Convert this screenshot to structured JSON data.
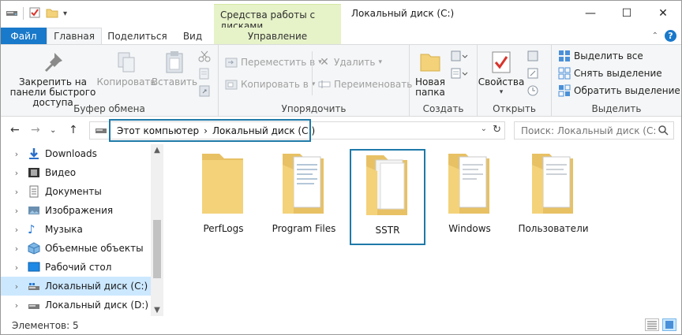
{
  "window": {
    "title": "Локальный диск (C:)",
    "context_group": "Средства работы с дисками",
    "minimize_glyph": "—",
    "maximize_glyph": "☐",
    "close_glyph": "✕"
  },
  "tabs": {
    "file": "Файл",
    "home": "Главная",
    "share": "Поделиться",
    "view": "Вид",
    "manage": "Управление"
  },
  "ribbon": {
    "clipboard": {
      "label": "Буфер обмена",
      "pin": "Закрепить на панели быстрого доступа",
      "copy": "Копировать",
      "paste": "Вставить"
    },
    "organize": {
      "label": "Упорядочить",
      "move_to": "Переместить в",
      "copy_to": "Копировать в",
      "delete": "Удалить",
      "rename": "Переименовать"
    },
    "new": {
      "label": "Создать",
      "new_folder": "Новая папка"
    },
    "open": {
      "label": "Открыть",
      "properties": "Свойства"
    },
    "select": {
      "label": "Выделить",
      "select_all": "Выделить все",
      "select_none": "Снять выделение",
      "invert": "Обратить выделение"
    }
  },
  "address": {
    "crumbs": [
      "Этот компьютер",
      "Локальный диск (C:)"
    ],
    "separator": "›"
  },
  "search": {
    "placeholder": "Поиск: Локальный диск (C:)"
  },
  "navpane": {
    "items": [
      {
        "label": "Downloads",
        "icon": "download-icon"
      },
      {
        "label": "Видео",
        "icon": "video-icon"
      },
      {
        "label": "Документы",
        "icon": "documents-icon"
      },
      {
        "label": "Изображения",
        "icon": "pictures-icon"
      },
      {
        "label": "Музыка",
        "icon": "music-icon"
      },
      {
        "label": "Объемные объекты",
        "icon": "3d-objects-icon"
      },
      {
        "label": "Рабочий стол",
        "icon": "desktop-icon"
      },
      {
        "label": "Локальный диск (C:)",
        "icon": "drive-icon",
        "selected": true
      },
      {
        "label": "Локальный диск (D:)",
        "icon": "drive-icon"
      }
    ]
  },
  "folders": [
    {
      "label": "PerfLogs",
      "variant": "empty"
    },
    {
      "label": "Program Files",
      "variant": "docs"
    },
    {
      "label": "SSTR",
      "variant": "pages",
      "highlighted": true
    },
    {
      "label": "Windows",
      "variant": "docs"
    },
    {
      "label": "Пользователи",
      "variant": "docs"
    }
  ],
  "status": {
    "count_text": "Элементов: 5"
  },
  "colors": {
    "accent": "#1979ca",
    "highlight_border": "#1f7aa8",
    "context_tab": "#e6f2c8",
    "selected_bg": "#cce8ff",
    "folder_yellow": "#f3d27a"
  }
}
